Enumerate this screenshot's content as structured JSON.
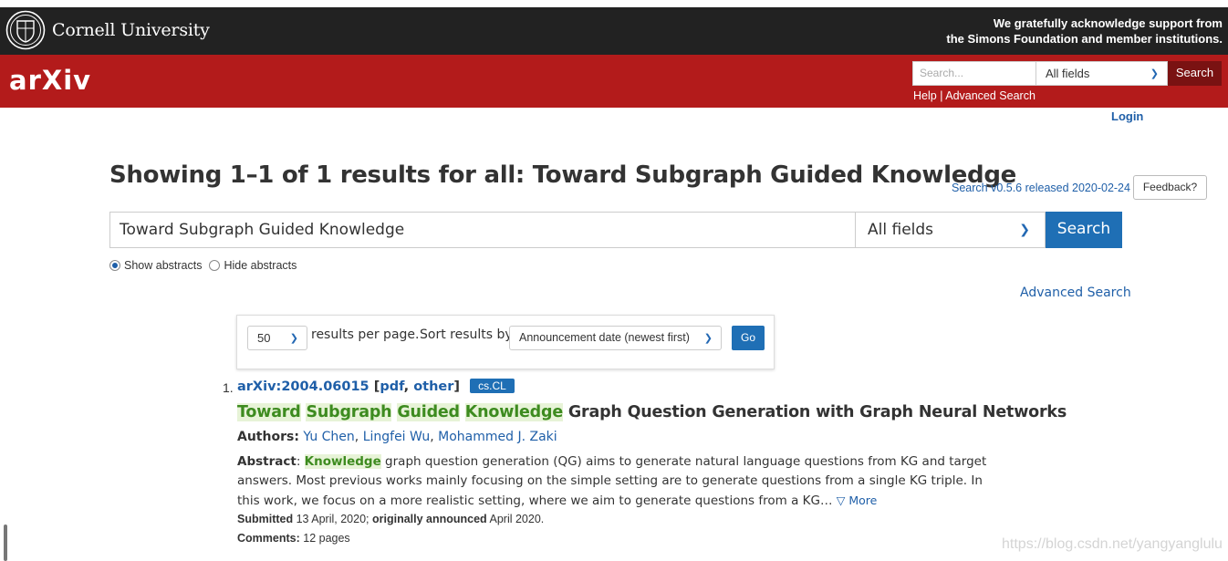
{
  "header": {
    "university": "Cornell University",
    "ack_line1": "We gratefully acknowledge support from",
    "ack_line2": "the Simons Foundation and member institutions.",
    "logo": "arXiv",
    "search_placeholder": "Search...",
    "field_select": "All fields",
    "search_button": "Search",
    "help_link": "Help",
    "separator": " | ",
    "advanced_link": "Advanced Search",
    "login": "Login"
  },
  "page": {
    "title": "Showing 1–1 of 1 results for all: Toward Subgraph Guided Knowledge",
    "version": "Search v0.5.6 released 2020-02-24",
    "feedback": "Feedback?"
  },
  "search": {
    "query": "Toward Subgraph Guided Knowledge",
    "field": "All fields",
    "button": "Search",
    "show_abstracts": "Show abstracts",
    "hide_abstracts": "Hide abstracts",
    "advanced": "Advanced Search"
  },
  "controls": {
    "per_page": "50",
    "per_page_label": "results per page.",
    "sort_label": "Sort results by",
    "sort_value": "Announcement date (newest first)",
    "go": "Go"
  },
  "result": {
    "number": "1.",
    "id": "arXiv:2004.06015",
    "bracket_open": "[",
    "pdf": "pdf",
    "comma": ", ",
    "other": "other",
    "bracket_close": "]",
    "category": "cs.CL",
    "title_hl1": "Toward",
    "title_hl2": "Subgraph",
    "title_hl3": "Guided",
    "title_hl4": "Knowledge",
    "title_rest": " Graph Question Generation with Graph Neural Networks",
    "authors_label": "Authors:",
    "author1": "Yu Chen",
    "author2": "Lingfei Wu",
    "author3": "Mohammed J. Zaki",
    "abstract_label": "Abstract",
    "abstract_keyword": "Knowledge",
    "abstract_text": " graph question generation (QG) aims to generate natural language questions from KG and target answers. Most previous works mainly focusing on the simple setting are to generate questions from a single KG triple. In this work, we focus on a more realistic setting, where we aim to generate questions from a KG… ",
    "more": "▽ More",
    "submitted_label": "Submitted",
    "submitted_date": " 13 April, 2020; ",
    "announced_label": "originally announced",
    "announced_date": " April 2020.",
    "comments_label": "Comments:",
    "comments_value": " 12 pages"
  },
  "watermark": "https://blog.csdn.net/yangyanglulu"
}
